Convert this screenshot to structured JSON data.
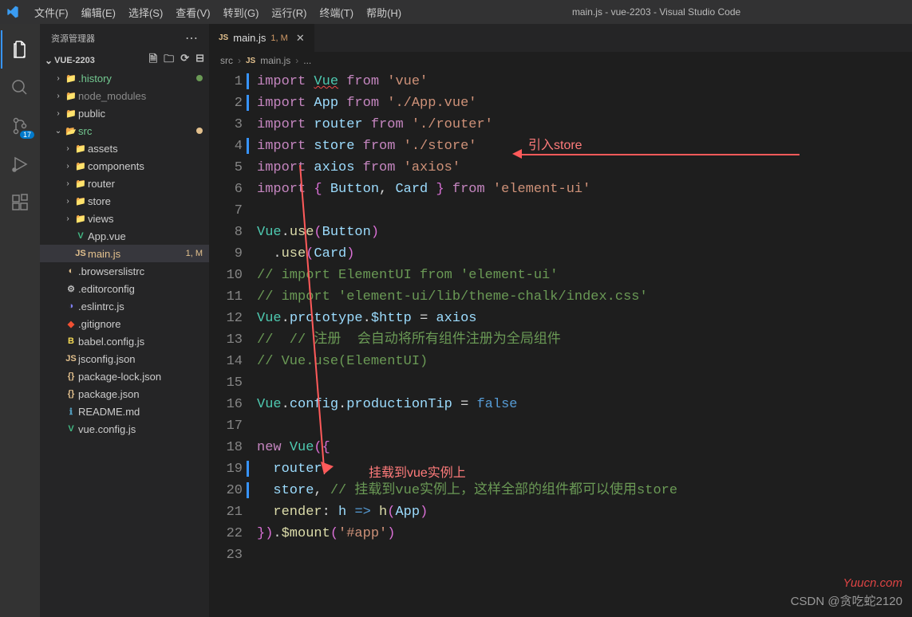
{
  "window": {
    "title": "main.js - vue-2203 - Visual Studio Code"
  },
  "menu": [
    "文件(F)",
    "编辑(E)",
    "选择(S)",
    "查看(V)",
    "转到(G)",
    "运行(R)",
    "终端(T)",
    "帮助(H)"
  ],
  "sidebar": {
    "title": "资源管理器",
    "project": "VUE-2203",
    "actions": [
      "new-file",
      "new-folder",
      "refresh",
      "collapse"
    ],
    "scm_badge": "17"
  },
  "tree": [
    {
      "depth": 1,
      "chev": "›",
      "label": ".history",
      "color": "#73c991",
      "dot": "#6a9955"
    },
    {
      "depth": 1,
      "chev": "›",
      "label": "node_modules",
      "color": "#8a8a8a"
    },
    {
      "depth": 1,
      "chev": "›",
      "label": "public"
    },
    {
      "depth": 1,
      "chev": "⌄",
      "label": "src",
      "color": "#73c991",
      "dot": "#e2c08d"
    },
    {
      "depth": 2,
      "chev": "›",
      "label": "assets"
    },
    {
      "depth": 2,
      "chev": "›",
      "label": "components"
    },
    {
      "depth": 2,
      "chev": "›",
      "label": "router"
    },
    {
      "depth": 2,
      "chev": "›",
      "label": "store"
    },
    {
      "depth": 2,
      "chev": "›",
      "label": "views"
    },
    {
      "depth": 2,
      "chev": "",
      "label": "App.vue",
      "icon": "V",
      "iconColor": "#42b883"
    },
    {
      "depth": 2,
      "chev": "",
      "label": "main.js",
      "icon": "JS",
      "iconColor": "#e2c08d",
      "meta": "1, M",
      "selected": true,
      "labelColor": "#e2c08d"
    },
    {
      "depth": 1,
      "chev": "",
      "label": ".browserslistrc",
      "icon": "◐",
      "iconColor": "#e2c08d"
    },
    {
      "depth": 1,
      "chev": "",
      "label": ".editorconfig",
      "icon": "⚙",
      "iconColor": "#bbb"
    },
    {
      "depth": 1,
      "chev": "",
      "label": ".eslintrc.js",
      "icon": "◑",
      "iconColor": "#8080f2"
    },
    {
      "depth": 1,
      "chev": "",
      "label": ".gitignore",
      "icon": "◆",
      "iconColor": "#f05033"
    },
    {
      "depth": 1,
      "chev": "",
      "label": "babel.config.js",
      "icon": "B",
      "iconColor": "#f5da55"
    },
    {
      "depth": 1,
      "chev": "",
      "label": "jsconfig.json",
      "icon": "JS",
      "iconColor": "#e2c08d"
    },
    {
      "depth": 1,
      "chev": "",
      "label": "package-lock.json",
      "icon": "{}",
      "iconColor": "#e2c08d"
    },
    {
      "depth": 1,
      "chev": "",
      "label": "package.json",
      "icon": "{}",
      "iconColor": "#e2c08d"
    },
    {
      "depth": 1,
      "chev": "",
      "label": "README.md",
      "icon": "ℹ",
      "iconColor": "#519aba"
    },
    {
      "depth": 1,
      "chev": "",
      "label": "vue.config.js",
      "icon": "V",
      "iconColor": "#42b883"
    }
  ],
  "tab": {
    "icon": "JS",
    "name": "main.js",
    "meta": "1, M"
  },
  "breadcrumb": [
    "src",
    "main.js",
    "..."
  ],
  "breadcrumb_icon": "JS",
  "code": {
    "lines": [
      {
        "n": 1,
        "mod": true,
        "html": "<span class='kw'>import</span> <span class='cls squiggle'>Vue</span> <span class='kw'>from</span> <span class='str'>'vue'</span>"
      },
      {
        "n": 2,
        "mod": true,
        "html": "<span class='kw'>import</span> <span class='var'>App</span> <span class='kw'>from</span> <span class='str'>'./App.vue'</span>"
      },
      {
        "n": 3,
        "html": "<span class='kw'>import</span> <span class='var'>router</span> <span class='kw'>from</span> <span class='str'>'./router'</span>"
      },
      {
        "n": 4,
        "mod": true,
        "html": "<span class='kw'>import</span> <span class='var'>store</span> <span class='kw'>from</span> <span class='str'>'./store'</span>"
      },
      {
        "n": 5,
        "html": "<span class='kw'>import</span> <span class='var'>axios</span> <span class='kw'>from</span> <span class='str'>'axios'</span>"
      },
      {
        "n": 6,
        "html": "<span class='kw'>import</span> <span class='brace'>{</span> <span class='var'>Button</span><span class='pun'>,</span> <span class='var'>Card</span> <span class='brace'>}</span> <span class='kw'>from</span> <span class='str'>'element-ui'</span>"
      },
      {
        "n": 7,
        "html": ""
      },
      {
        "n": 8,
        "html": "<span class='cls'>Vue</span><span class='pun'>.</span><span class='fn'>use</span><span class='brace'>(</span><span class='var'>Button</span><span class='brace'>)</span>"
      },
      {
        "n": 9,
        "html": "  <span class='pun'>.</span><span class='fn'>use</span><span class='brace'>(</span><span class='var'>Card</span><span class='brace'>)</span>"
      },
      {
        "n": 10,
        "html": "<span class='cmt'>// import ElementUI from 'element-ui'</span>"
      },
      {
        "n": 11,
        "html": "<span class='cmt'>// import 'element-ui/lib/theme-chalk/index.css'</span>"
      },
      {
        "n": 12,
        "html": "<span class='cls'>Vue</span><span class='pun'>.</span><span class='var'>prototype</span><span class='pun'>.</span><span class='var'>$http</span> <span class='pun'>=</span> <span class='var'>axios</span>"
      },
      {
        "n": 13,
        "html": "<span class='cmt'>//  // 注册  会自动将所有组件注册为全局组件</span>"
      },
      {
        "n": 14,
        "html": "<span class='cmt'>// Vue.use(ElementUI)</span>"
      },
      {
        "n": 15,
        "html": ""
      },
      {
        "n": 16,
        "html": "<span class='cls'>Vue</span><span class='pun'>.</span><span class='var'>config</span><span class='pun'>.</span><span class='var'>productionTip</span> <span class='pun'>=</span> <span class='num'>false</span>"
      },
      {
        "n": 17,
        "html": ""
      },
      {
        "n": 18,
        "html": "<span class='kw'>new</span> <span class='cls'>Vue</span><span class='brace'>({</span>"
      },
      {
        "n": 19,
        "mod": true,
        "html": "  <span class='var'>router</span><span class='pun'>,</span>"
      },
      {
        "n": 20,
        "mod": true,
        "html": "  <span class='var'>store</span><span class='pun'>,</span> <span class='cmt'>// 挂载到vue实例上，这样全部的组件都可以使用store</span>"
      },
      {
        "n": 21,
        "html": "  <span class='fn'>render</span><span class='pun'>:</span> <span class='var'>h</span> <span class='num'>=></span> <span class='fn'>h</span><span class='brace'>(</span><span class='var'>App</span><span class='brace'>)</span>"
      },
      {
        "n": 22,
        "html": "<span class='brace'>})</span><span class='pun'>.</span><span class='fn'>$mount</span><span class='brace'>(</span><span class='str'>'#app'</span><span class='brace'>)</span>"
      },
      {
        "n": 23,
        "html": ""
      }
    ]
  },
  "annotations": {
    "a1": "引入store",
    "a2": "挂载到vue实例上"
  },
  "watermarks": {
    "w1": "Yuucn.com",
    "w2": "CSDN @贪吃蛇2120"
  }
}
